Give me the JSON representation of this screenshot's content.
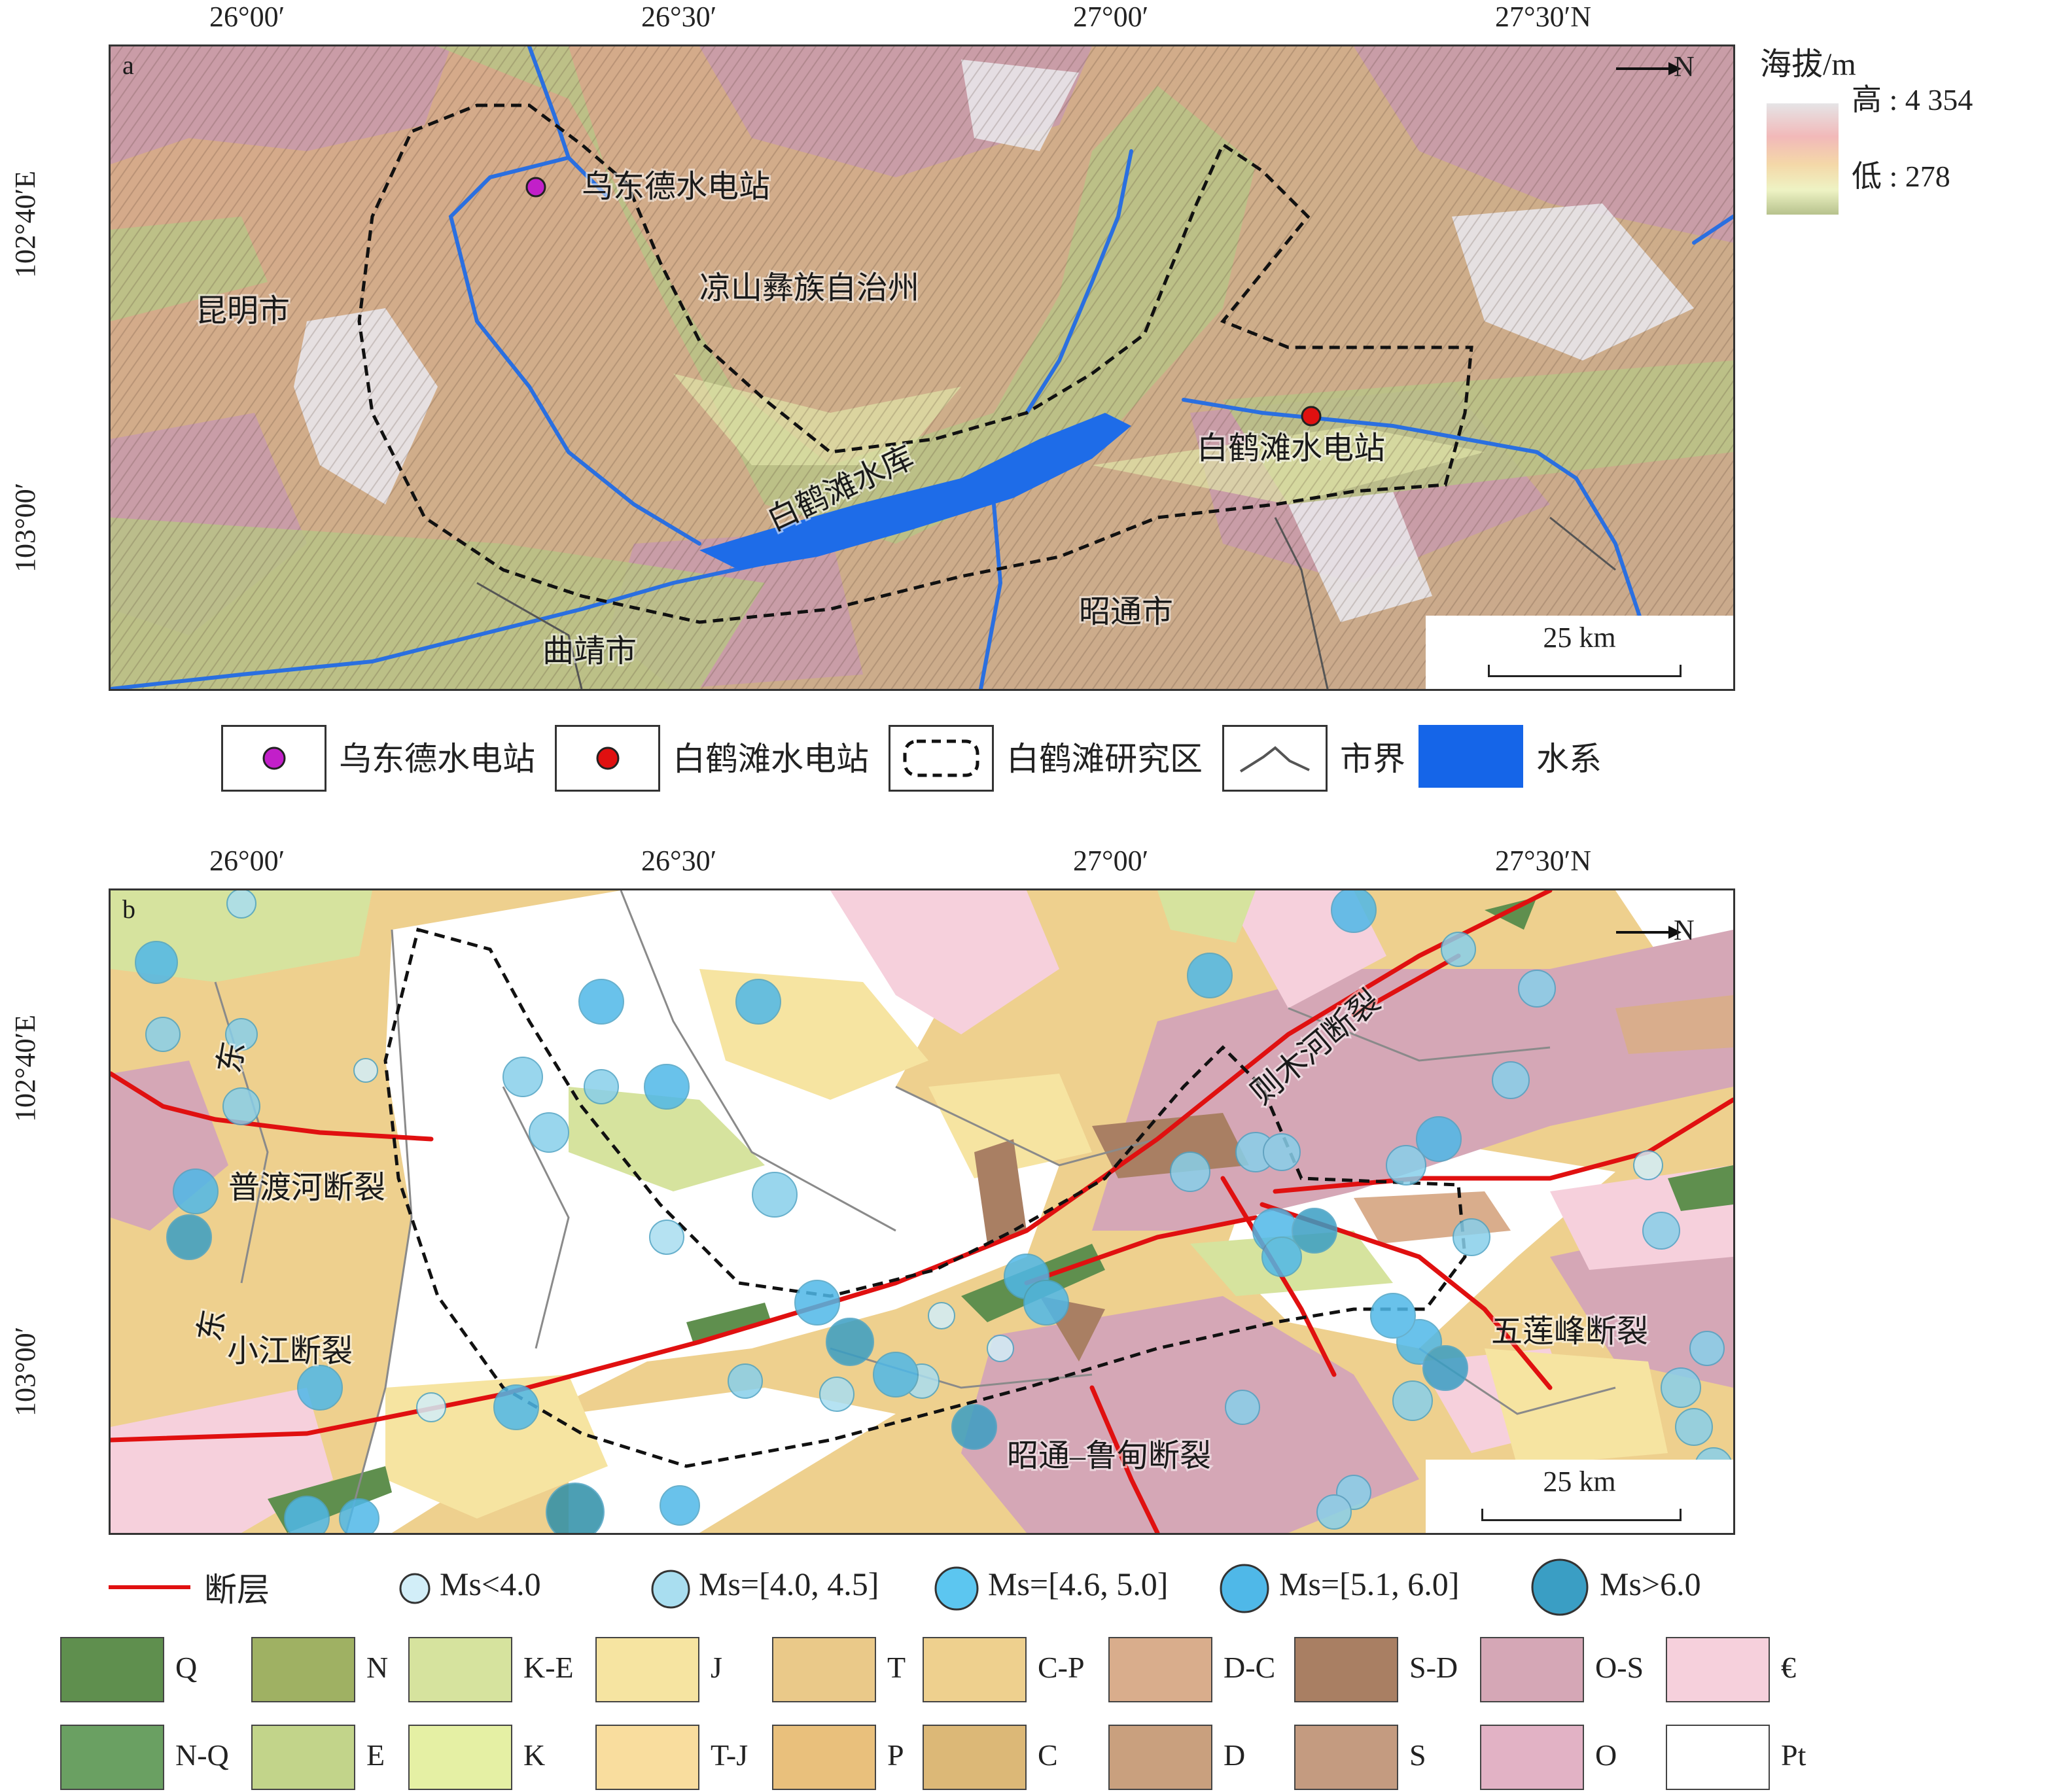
{
  "top_axis_labels": [
    "26°00′",
    "26°30′",
    "27°00′",
    "27°30′N"
  ],
  "left_axis_labels": [
    "102°40′E",
    "103°00′"
  ],
  "north_arrow": "N",
  "map_a": {
    "panel_label": "a",
    "places": {
      "wudongde": "乌东德水电站",
      "liangshan": "凉山彝族自治州",
      "kunming": "昆明市",
      "reservoir": "白鹤滩水库",
      "baihetan": "白鹤滩水电站",
      "zhaotong": "昭通市",
      "qujing": "曲靖市"
    },
    "scale": "25 km",
    "elevation": {
      "title": "海拔/m",
      "high": "高 : 4 354",
      "low": "低 : 278"
    }
  },
  "legend_a": [
    {
      "label": "乌东德水电站",
      "icon": "magenta-dot",
      "color": "#c21fc9"
    },
    {
      "label": "白鹤滩水电站",
      "icon": "red-dot",
      "color": "#e01010"
    },
    {
      "label": "白鹤滩研究区",
      "icon": "dashed-boundary"
    },
    {
      "label": "市界",
      "icon": "boundary-line"
    },
    {
      "label": "水系",
      "icon": "water-swatch",
      "color": "#1565e8"
    }
  ],
  "map_b": {
    "panel_label": "b",
    "faults": {
      "zemuhe": "则木河断裂",
      "pudu": "普渡河断裂",
      "xiaojiang": "小江断裂",
      "xiaojiang_east_1": "东",
      "xiaojiang_east_2": "东",
      "wulianfeng": "五莲峰断裂",
      "zhaotong_ludian": "昭通–鲁甸断裂"
    },
    "scale": "25 km"
  },
  "legend_b_symbols": [
    {
      "label": "断层",
      "icon": "fault-line",
      "color": "#e01010"
    },
    {
      "label": "Ms<4.0",
      "icon": "eq-circle-1"
    },
    {
      "label": "Ms=[4.0, 4.5]",
      "icon": "eq-circle-2"
    },
    {
      "label": "Ms=[4.6, 5.0]",
      "icon": "eq-circle-3"
    },
    {
      "label": "Ms=[5.1, 6.0]",
      "icon": "eq-circle-4"
    },
    {
      "label": "Ms>6.0",
      "icon": "eq-circle-5"
    }
  ],
  "legend_b_units": [
    {
      "label": "Q",
      "color": "#5f8f4e"
    },
    {
      "label": "N",
      "color": "#9fb163"
    },
    {
      "label": "K-E",
      "color": "#d6e39e"
    },
    {
      "label": "J",
      "color": "#f6e4a1"
    },
    {
      "label": "T",
      "color": "#eac989"
    },
    {
      "label": "C-P",
      "color": "#eed08e"
    },
    {
      "label": "D-C",
      "color": "#d9ad8c"
    },
    {
      "label": "S-D",
      "color": "#a97f63"
    },
    {
      "label": "O-S",
      "color": "#d5a7b6"
    },
    {
      "label": "€",
      "color": "#f6d0dc"
    },
    {
      "label": "N-Q",
      "color": "#6aa062"
    },
    {
      "label": "E",
      "color": "#c2d48a"
    },
    {
      "label": "K",
      "color": "#e5f0a4"
    },
    {
      "label": "T-J",
      "color": "#f9dd9e"
    },
    {
      "label": "P",
      "color": "#e9c07c"
    },
    {
      "label": "C",
      "color": "#dcb877"
    },
    {
      "label": "D",
      "color": "#c9a07e"
    },
    {
      "label": "S",
      "color": "#c49b80"
    },
    {
      "label": "O",
      "color": "#e2b2c5"
    },
    {
      "label": "Pt",
      "color": "#ffffff"
    }
  ]
}
